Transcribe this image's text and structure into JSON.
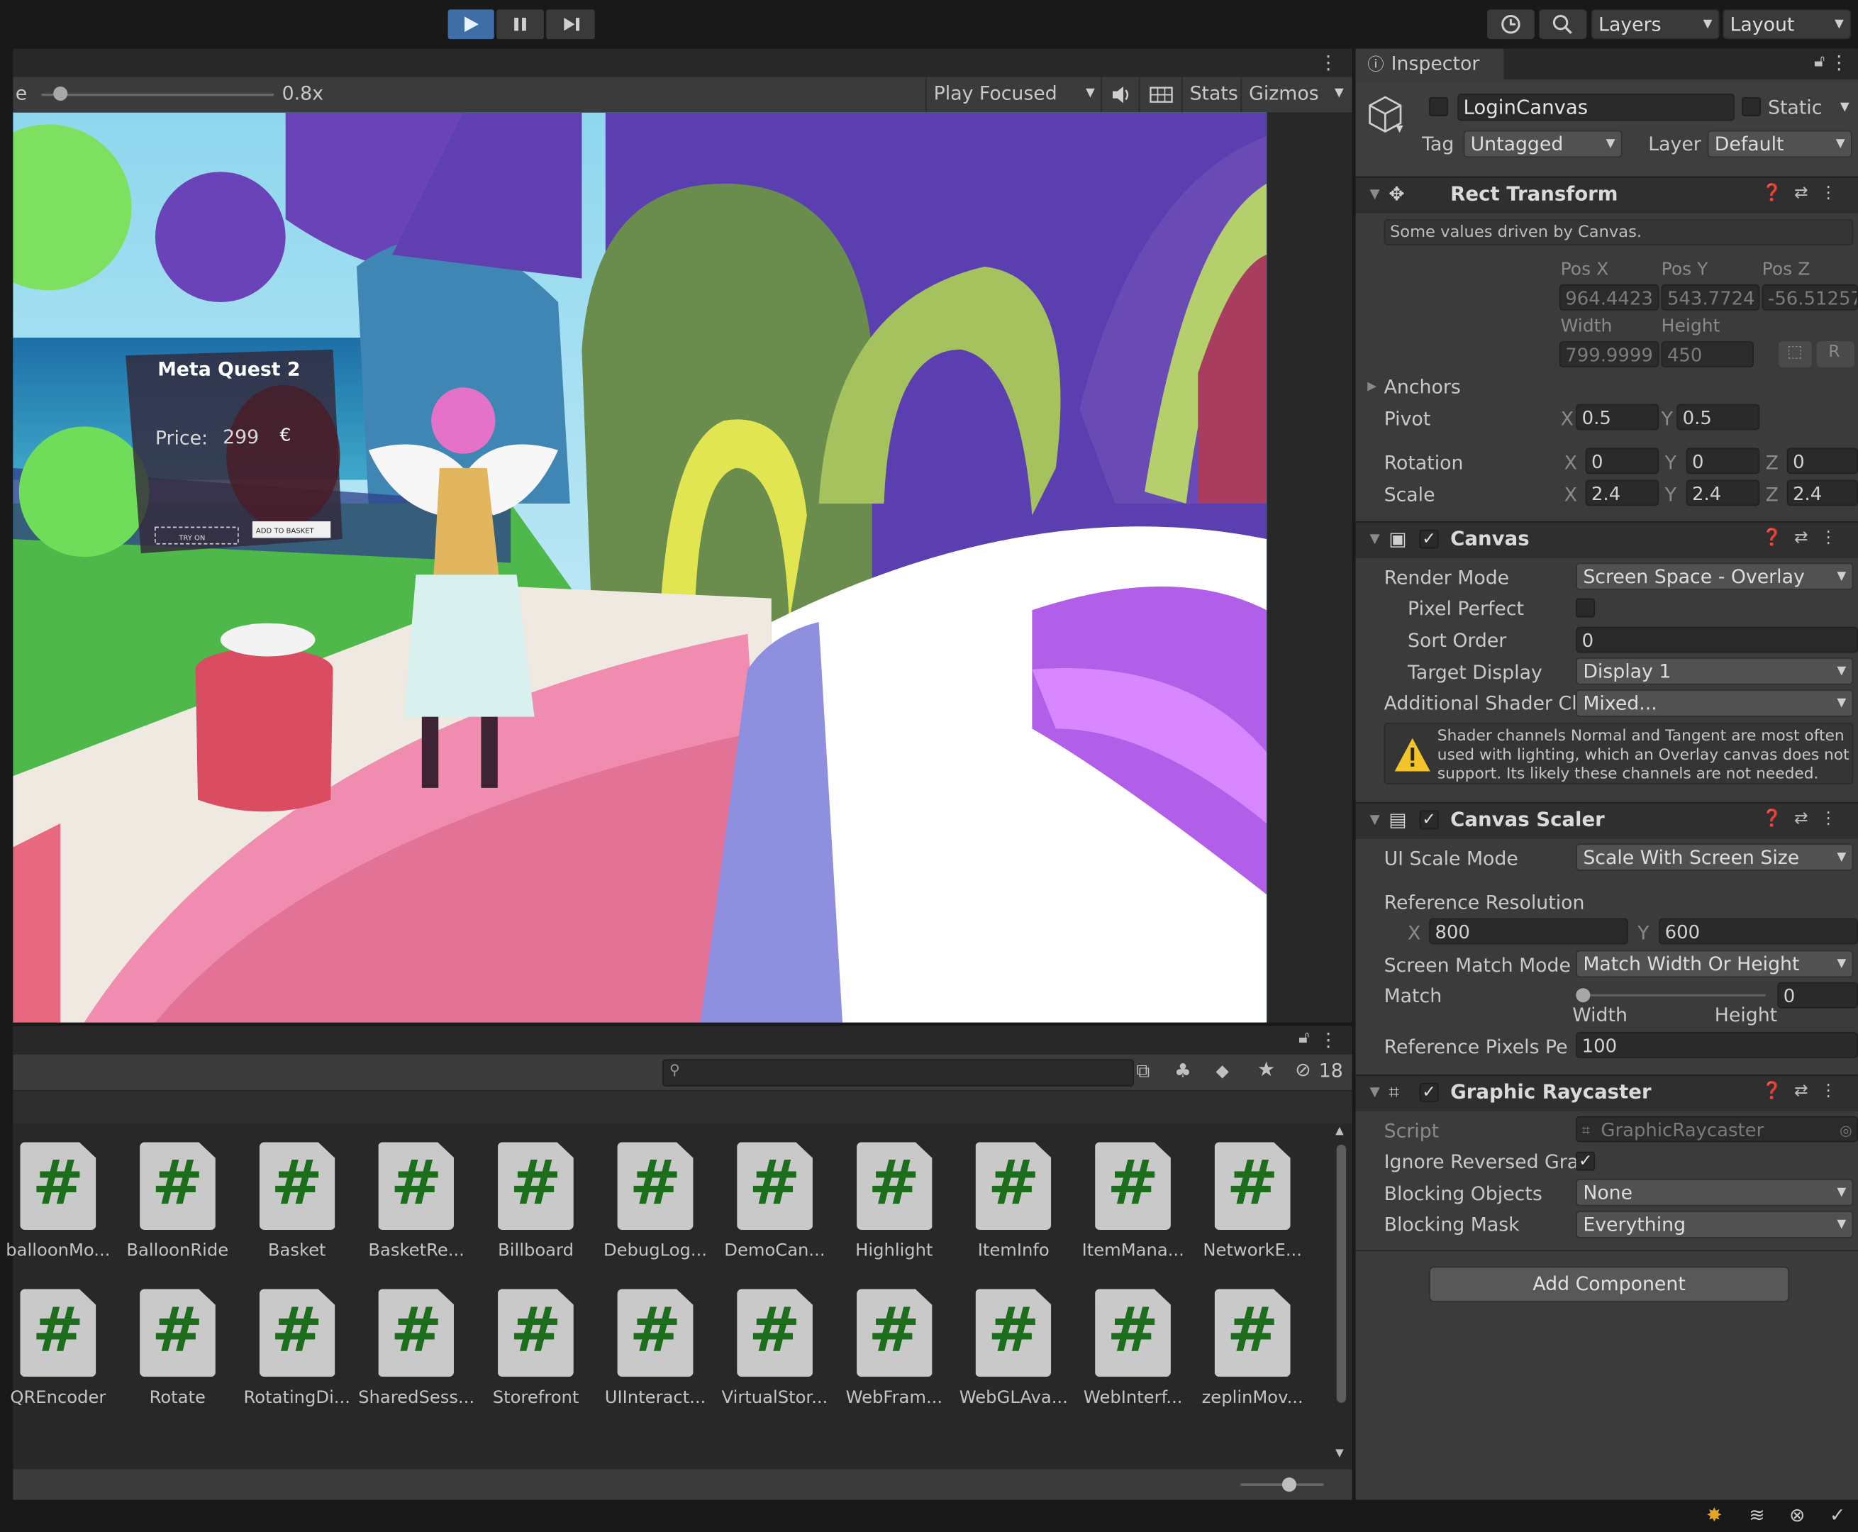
{
  "toolbar": {
    "play_icon": "play-icon",
    "pause_icon": "pause-icon",
    "step_icon": "step-icon",
    "layers_label": "Layers",
    "layout_label": "Layout"
  },
  "game_view": {
    "scale_prefix": "e",
    "scale_value": "0.8x",
    "scale_fraction": 0.05,
    "play_focused": "Play Focused",
    "stats": "Stats",
    "gizmos": "Gizmos"
  },
  "scene": {
    "panel_title": "Meta Quest 2",
    "price_label": "Price:",
    "price_value": "299",
    "currency": "€",
    "try_on": "TRY ON",
    "add_to_basket": "ADD TO BASKET"
  },
  "inspector": {
    "tab_label": "Inspector",
    "object": {
      "name": "LoginCanvas",
      "static_label": "Static",
      "tag_label": "Tag",
      "tag_value": "Untagged",
      "layer_label": "Layer",
      "layer_value": "Default"
    },
    "rect_transform": {
      "title": "Rect Transform",
      "note": "Some values driven by Canvas.",
      "pos_x_label": "Pos X",
      "pos_y_label": "Pos Y",
      "pos_z_label": "Pos Z",
      "pos_x": "964.4423",
      "pos_y": "543.7724",
      "pos_z": "-56.51257",
      "width_label": "Width",
      "height_label": "Height",
      "width": "799.9999",
      "height": "450",
      "r_button": "R",
      "anchors": "Anchors",
      "pivot": "Pivot",
      "pivot_x": "0.5",
      "pivot_y": "0.5",
      "rotation": "Rotation",
      "rot_x": "0",
      "rot_y": "0",
      "rot_z": "0",
      "scale": "Scale",
      "scale_x": "2.4",
      "scale_y": "2.4",
      "scale_z": "2.4",
      "x": "X",
      "y": "Y",
      "z": "Z"
    },
    "canvas": {
      "title": "Canvas",
      "render_mode_label": "Render Mode",
      "render_mode": "Screen Space - Overlay",
      "pixel_perfect_label": "Pixel Perfect",
      "sort_order_label": "Sort Order",
      "sort_order": "0",
      "target_display_label": "Target Display",
      "target_display": "Display 1",
      "shader_label": "Additional Shader Cl",
      "shader_value": "Mixed...",
      "warning_1": "Shader channels Normal and Tangent are most often",
      "warning_2": "used with lighting, which an Overlay canvas does not",
      "warning_3": "support. Its likely these channels are not needed."
    },
    "canvas_scaler": {
      "title": "Canvas Scaler",
      "ui_scale_label": "UI Scale Mode",
      "ui_scale": "Scale With Screen Size",
      "ref_res_label": "Reference Resolution",
      "x_label": "X",
      "y_label": "Y",
      "ref_x": "800",
      "ref_y": "600",
      "match_mode_label": "Screen Match Mode",
      "match_mode": "Match Width Or Height",
      "match_label": "Match",
      "match_value": "0",
      "width_label": "Width",
      "height_label": "Height",
      "ref_pixels_label": "Reference Pixels Pe",
      "ref_pixels": "100"
    },
    "graphic_raycaster": {
      "title": "Graphic Raycaster",
      "script_label": "Script",
      "script_value": "GraphicRaycaster",
      "ignore_label": "Ignore Reversed Gra",
      "blocking_objects_label": "Blocking Objects",
      "blocking_objects": "None",
      "blocking_mask_label": "Blocking Mask",
      "blocking_mask": "Everything"
    },
    "add_component": "Add Component"
  },
  "project": {
    "hidden_count": "18",
    "row1": [
      "balloonMo...",
      "BalloonRide",
      "Basket",
      "BasketRe...",
      "Billboard",
      "DebugLog...",
      "DemoCan...",
      "Highlight",
      "ItemInfo",
      "ItemMana...",
      "NetworkE..."
    ],
    "row2": [
      "QREncoder",
      "Rotate",
      "RotatingDi...",
      "SharedSess...",
      "Storefront",
      "UIInteract...",
      "VirtualStor...",
      "WebFram...",
      "WebGLAva...",
      "WebInterf...",
      "zeplinMov..."
    ],
    "icon_glyph": "#"
  }
}
